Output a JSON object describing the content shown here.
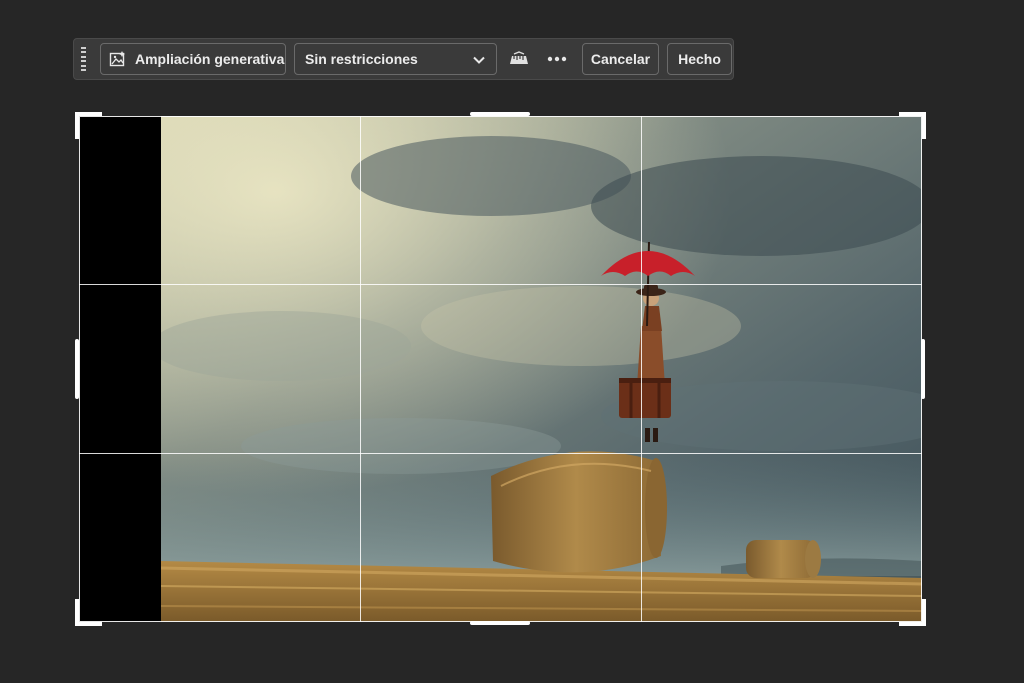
{
  "toolbar": {
    "generative_expand_label": "Ampliación generativa",
    "aspect_select_value": "Sin restricciones",
    "cancel_label": "Cancelar",
    "done_label": "Hecho",
    "icons": [
      "grip-handle-icon",
      "generative-expand-icon",
      "chevron-down-icon",
      "straighten-icon",
      "more-options-icon"
    ]
  },
  "canvas": {
    "overlay": "rule-of-thirds",
    "colors": {
      "background": "#262626",
      "toolbar": "#3a3a3a",
      "empty_area": "#000000",
      "umbrella": "#c8202a"
    }
  }
}
